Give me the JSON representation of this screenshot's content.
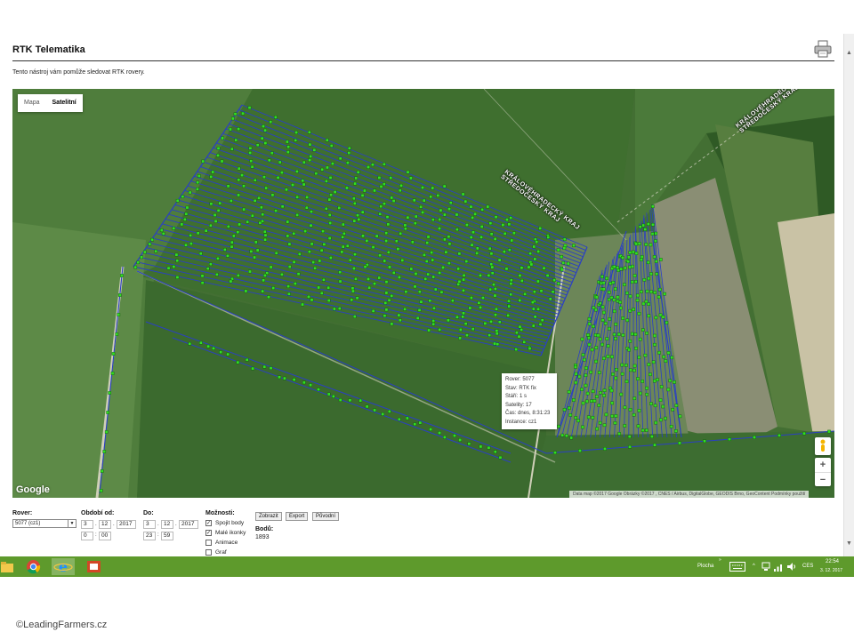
{
  "page": {
    "title": "RTK Telematika",
    "description": "Tento nástroj vám pomůže sledovat RTK rovery."
  },
  "map": {
    "type_options": [
      "Mapa",
      "Satelitní"
    ],
    "active_type": "Satelitní",
    "region_label_1": [
      "KRÁLOVÉHRADECKÝ KRAJ",
      "STŘEDOČESKÝ KRAJ"
    ],
    "region_label_2": [
      "KRÁLOVÉHRADECKÝ KRAJ",
      "STŘEDOČESKÝ KRAJ"
    ],
    "info": {
      "rover": "Rover: 5077",
      "state": "Stav: RTK fix",
      "age": "Stáří: 1 s",
      "satellites": "Satelity: 17",
      "time": "Čas: dnes, 8:31:23",
      "instance": "Instance: cz1"
    },
    "zoom_in": "+",
    "zoom_out": "−",
    "logo": "Google",
    "attribution": "Data map ©2017 Google Obrázky ©2017 , CNES / Airbus, DigitalGlobe, GEODIS Brno, GeoContent   Podmínky použití",
    "track_color": "#2a3fc4",
    "point_color": "#33dd22"
  },
  "controls": {
    "rover_label": "Rover:",
    "rover_value": "5077 (cz1)",
    "from_label": "Období od:",
    "from_day": "3",
    "from_month": "12",
    "from_year": "2017",
    "from_hour": "0",
    "from_min": "00",
    "to_label": "Do:",
    "to_day": "3",
    "to_month": "12",
    "to_year": "2017",
    "to_hour": "23",
    "to_min": "59",
    "options_label": "Možnosti:",
    "opt_connect": "Spojit body",
    "opt_small": "Malé ikonky",
    "opt_anim": "Animace",
    "opt_graph": "Graf",
    "btn_show": "Zobrazit",
    "btn_export": "Export",
    "btn_orig": "Původní",
    "points_label": "Bodů:",
    "points_value": "1893"
  },
  "taskbar": {
    "desktop_label": "Plocha",
    "language": "CES",
    "time": "22:54",
    "date": "3. 12. 2017"
  },
  "footer": {
    "copyright": "©LeadingFarmers.cz"
  }
}
